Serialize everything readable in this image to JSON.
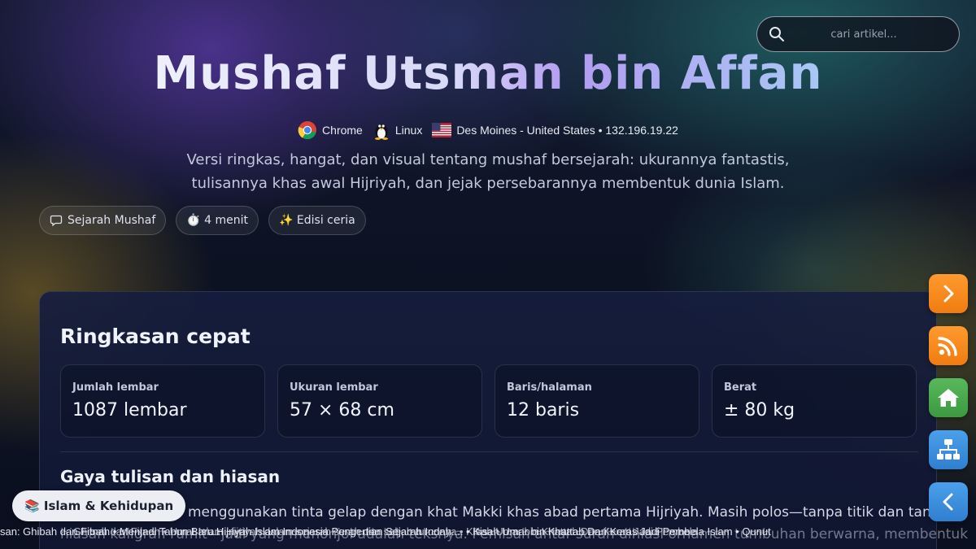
{
  "search": {
    "placeholder": "cari artikel..."
  },
  "header": {
    "title": "Mushaf Utsman bin Affan",
    "meta": {
      "browser": "Chrome",
      "os": "Linux",
      "location": "Des Moines - United States • 132.196.19.22"
    },
    "subtitle_line1": "Versi ringkas, hangat, dan visual tentang mushaf bersejarah: ukurannya fantastis,",
    "subtitle_line2": "tulisannya khas awal Hijriyah, dan jejak persebarannya membentuk dunia Islam."
  },
  "chips": [
    {
      "icon": "chat-bubble-icon",
      "label": "Sejarah Mushaf"
    },
    {
      "icon": "stopwatch-icon",
      "label": "⏱️ 4 menit"
    },
    {
      "icon": "sparkles-icon",
      "label": "✨ Edisi ceria"
    }
  ],
  "summary": {
    "heading": "Ringkasan cepat",
    "stats": [
      {
        "label": "Jumlah lembar",
        "value": "1087 lembar"
      },
      {
        "label": "Ukuran lembar",
        "value": "57 × 68 cm"
      },
      {
        "label": "Baris/halaman",
        "value": "12 baris"
      },
      {
        "label": "Berat",
        "value": "± 80 kg"
      }
    ],
    "section_heading": "Gaya tulisan dan hiasan",
    "paragraph_line1": "menggunakan tinta gelap dengan khat Makki khas abad pertama Hijriyah. Masih polos—tanpa titik dan tanpa",
    "paragraph_line2": "hiasan kaligrafi rumit—jadi yang menonjol adalah teksnya. Pemisah antar surah dihiasi ornamen tumbuhan berwarna, membentuk"
  },
  "category_badge": {
    "label": "📚 Islam & Kehidupan"
  },
  "ticker": {
    "front": "san: Ghibah dan Fitnah    •  Menjadi Tahun Baru Hijriyah Islam Indonesia  Pengertian Sejarah Indah ...   •  Kisah Umar bin Khattab Dari Keras Jadi Pembela Islam    •  Qunut",
    "back": "Ghibah dan Fitnah   •  Umat Islam Hijriyah dalam sejarah surah dan sebab turunnya   •   Kisah Umar bin Khattab Dan Keras Jadi Pembela"
  },
  "side_buttons": [
    {
      "icon": "chevron-right-icon",
      "color": "#f58a1f"
    },
    {
      "icon": "rss-icon",
      "color": "#f58a1f"
    },
    {
      "icon": "home-icon",
      "color": "#4caa4f"
    },
    {
      "icon": "sitemap-icon",
      "color": "#3c8fe0"
    },
    {
      "icon": "chevron-left-icon",
      "color": "#3c8fe0"
    }
  ]
}
